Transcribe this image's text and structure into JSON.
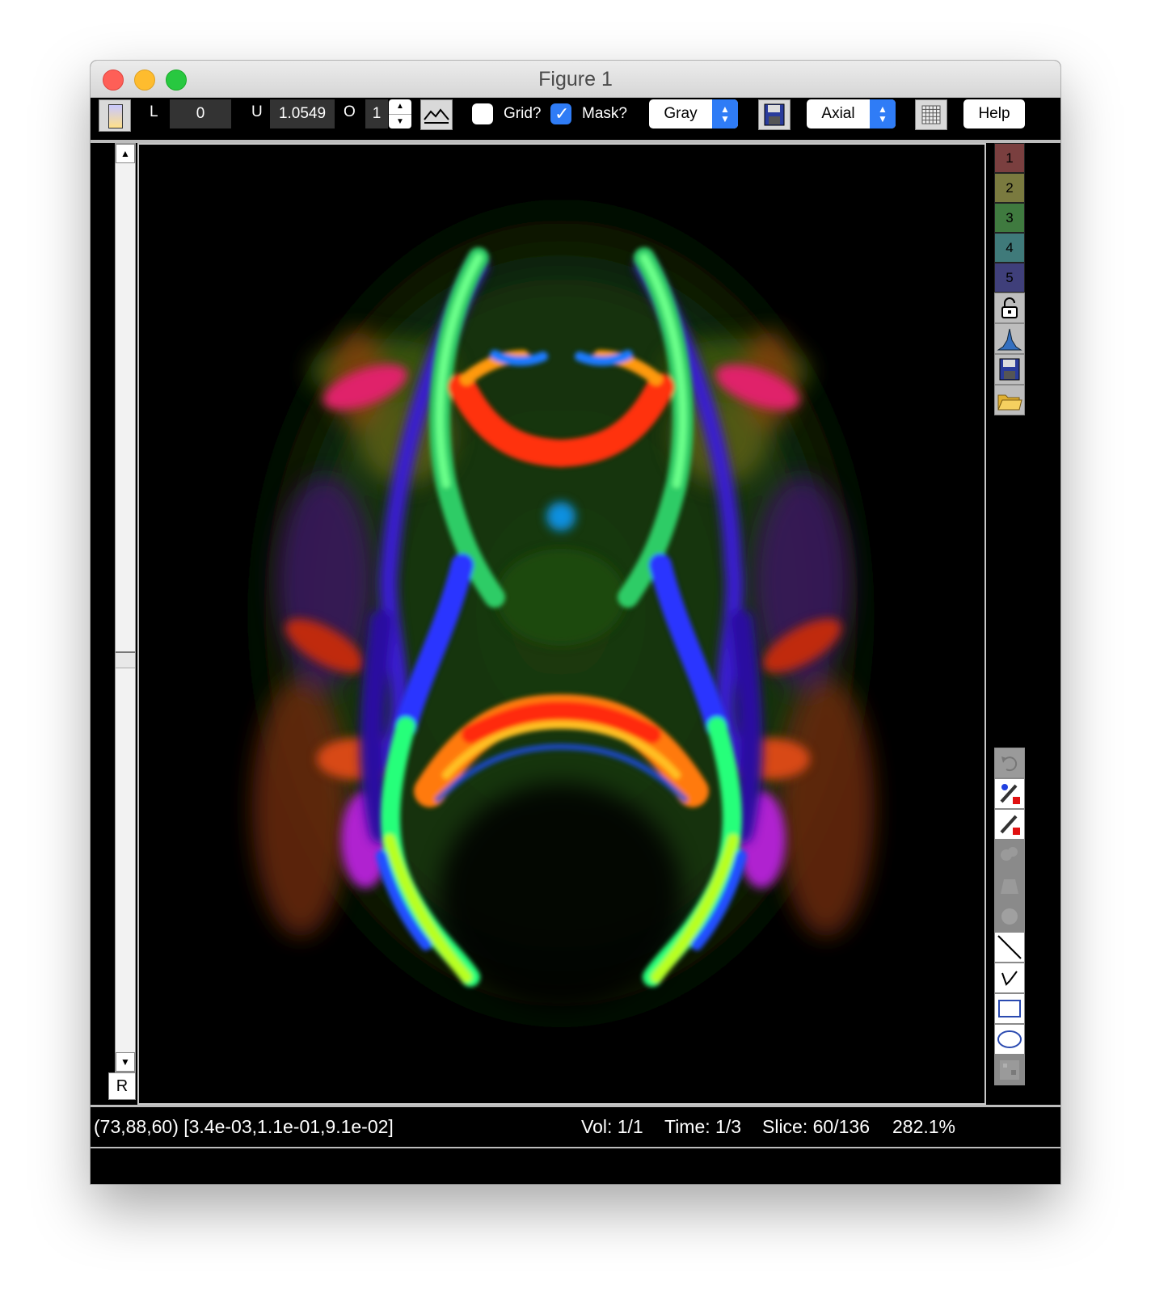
{
  "window": {
    "title": "Figure 1"
  },
  "toolbar": {
    "lower_label": "L",
    "lower_value": "0",
    "upper_label": "U",
    "upper_value": "1.0549",
    "opacity_label": "O",
    "opacity_value": "1",
    "grid_label": "Grid?",
    "grid_checked": false,
    "mask_label": "Mask?",
    "mask_checked": true,
    "colormap_value": "Gray",
    "view_value": "Axial",
    "help_label": "Help"
  },
  "scrollbar": {
    "position_fraction": 0.56
  },
  "orientation_button": "R",
  "side_panel": {
    "rois": [
      {
        "label": "1",
        "color": "#7a3f3f"
      },
      {
        "label": "2",
        "color": "#7a7a3f"
      },
      {
        "label": "3",
        "color": "#3f7a3f"
      },
      {
        "label": "4",
        "color": "#3f7a7a"
      },
      {
        "label": "5",
        "color": "#3f3f7a"
      }
    ]
  },
  "status": {
    "cursor": "(73,88,60) [3.4e-03,1.1e-01,9.1e-02]",
    "vol": "Vol: 1/1",
    "time": "Time: 1/3",
    "slice": "Slice: 60/136",
    "zoom": "282.1%"
  }
}
